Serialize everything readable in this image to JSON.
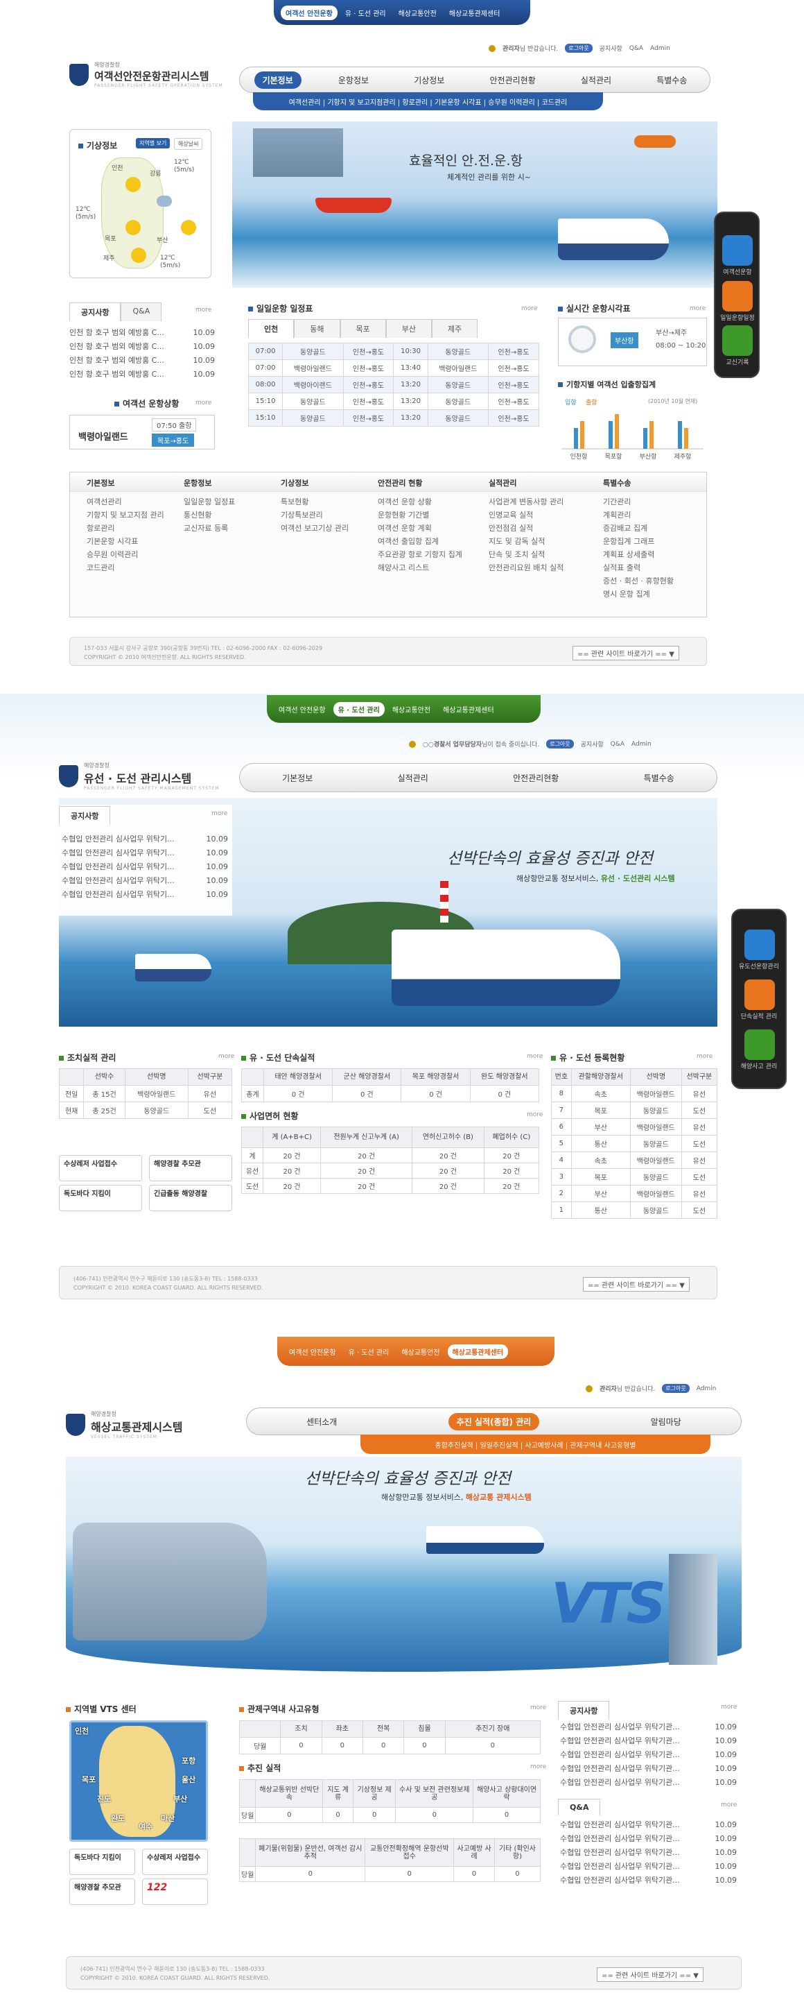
{
  "s1": {
    "topnav": [
      "여객선 안전운항",
      "유 · 도선 관리",
      "해상교통안전",
      "해상교통관제센터"
    ],
    "logo": {
      "sub": "해양경찰청",
      "main": "여객선안전운항관리시스템",
      "eng": "PASSENGER FLIGHT SAFETY OPERATION SYSTEM"
    },
    "util": {
      "user": "관리자",
      "greet": "님 반갑습니다.",
      "logout": "로그아웃",
      "q1": "공지사항",
      "q2": "Q&A",
      "q3": "Admin"
    },
    "mainmenu": [
      "기본정보",
      "운항정보",
      "기상정보",
      "안전관리현황",
      "실적관리",
      "특별수송"
    ],
    "submenu": "여객선관리 | 기항지 및 보고지점관리 | 항로관리 | 기본운항 시각표 | 승무원 이력관리 | 코드관리",
    "weather": {
      "title": "기상정보",
      "btn1": "지역별 보기",
      "btn2": "해상날씨",
      "cities": [
        "인천",
        "강릉",
        "목포",
        "부산",
        "제주"
      ],
      "readings": [
        "12℃ (5m/s)",
        "12℃ (5m/s)",
        "12℃ (5m/s)"
      ]
    },
    "hero": {
      "title": "효율적인 안.전.운.항",
      "sub": "체계적인 관리를 위한 시~"
    },
    "notice": {
      "tab1": "공지사항",
      "tab2": "Q&A",
      "more": "more",
      "items": [
        {
          "t": "인천 항 호구 범외 예방홍 C...",
          "d": "10.09"
        },
        {
          "t": "인천 항 호구 범외 예방홍 C...",
          "d": "10.09"
        },
        {
          "t": "인천 항 호구 범외 예방홍 C...",
          "d": "10.09"
        },
        {
          "t": "인천 항 호구 범외 예방홍 C...",
          "d": "10.09"
        }
      ]
    },
    "status": {
      "title": "여객선 운항상황",
      "more": "more",
      "ship": "백령아일랜드",
      "time": "07:50 출항",
      "route": "목포→홍도"
    },
    "schedule": {
      "title": "일일운항 일정표",
      "more": "more",
      "tabs": [
        "인천",
        "동해",
        "목포",
        "부산",
        "제주"
      ],
      "rows": [
        [
          "07:00",
          "동양골드",
          "인천→홍도",
          "10:30",
          "동양골드",
          "인천→홍도"
        ],
        [
          "07:00",
          "백령아일랜드",
          "인천→홍도",
          "13:40",
          "백령아일랜드",
          "인천→홍도"
        ],
        [
          "08:00",
          "백령아이랜드",
          "인천→홍도",
          "13:20",
          "동양골드",
          "인천→홍도"
        ],
        [
          "15:10",
          "동양골드",
          "인천→홍도",
          "13:20",
          "동양골드",
          "인천→홍도"
        ],
        [
          "15:10",
          "동양골드",
          "인천→홍도",
          "13:20",
          "동양골드",
          "인천→홍도"
        ]
      ]
    },
    "realtime": {
      "title": "실시간 운항시각표",
      "more": "more",
      "port": "부산항",
      "route": "부산→제주",
      "time": "08:00 ~ 10:20"
    },
    "pax": {
      "title": "기항지별 여객선 입출항집계",
      "legend1": "입항",
      "legend2": "출항",
      "note": "(2010년 10월 현재)",
      "cats": [
        "인천항",
        "목포항",
        "부산항",
        "제주항"
      ],
      "in": [
        3,
        4,
        3,
        4
      ],
      "out": [
        4,
        5,
        4,
        3
      ]
    },
    "phone": [
      "여객선운항",
      "일일운항일정",
      "교신기록"
    ],
    "sitemap": [
      {
        "h": "기본정보",
        "i": [
          "여객선관리",
          "기항지 및 보고지점 관리",
          "항로관리",
          "기본운항 시각표",
          "승무원 이력관리",
          "코드관리"
        ]
      },
      {
        "h": "운항정보",
        "i": [
          "일일운항 일정표",
          "통신현황",
          "교신자료 등록"
        ]
      },
      {
        "h": "기상정보",
        "i": [
          "특보현황",
          "기상특보관리",
          "여객선 보고기상 관리"
        ]
      },
      {
        "h": "안전관리 현황",
        "i": [
          "여객선 운항 상황",
          "운항현황 기간별",
          "여객선 운항 계획",
          "여객선 출입항 집계",
          "주요관광 항로 기항지 집계",
          "해양사고 리스트"
        ]
      },
      {
        "h": "실적관리",
        "i": [
          "사업관계 변동사항 관리",
          "인명교육 실적",
          "안전점검 실적",
          "지도 및 감독 실적",
          "단속 및 조치 실적",
          "안전관리요원 배치 실적"
        ]
      },
      {
        "h": "특별수송",
        "i": [
          "기간관리",
          "계획관리",
          "증감배교 집계",
          "운항집계 그래프",
          "계획표 상세출력",
          "실적표 출력",
          "증선 · 회선 · 휴항현황",
          "명시 운항 집계"
        ]
      }
    ],
    "footer": {
      "l1": "157-033 서울시 강서구 공항로 390(공항동 39번지) TEL : 02-6096-2000  FAX : 02-6096-2029",
      "l2": "COPYRIGHT © 2010 여객선안전운항. ALL RIGHTS RESERVED.",
      "sel": "== 관련 사이트 바로가기 ==",
      "arrow": "▼"
    }
  },
  "s2": {
    "topnav": [
      "여객선 안전운항",
      "유 · 도선 관리",
      "해상교통안전",
      "해상교통관제센터"
    ],
    "logo": {
      "sub": "해양경찰청",
      "main": "유선 · 도선 관리시스템",
      "eng": "PASSENGER FLIGHT SAFETY MANAGEMENT SYSTEM"
    },
    "util": {
      "user": "○○경찰서 업무담당자",
      "greet": "님이 접속 중이십니다.",
      "logout": "로그아웃",
      "q1": "공지사항",
      "q2": "Q&A",
      "q3": "Admin"
    },
    "mainmenu": [
      "기본정보",
      "실적관리",
      "안전관리현황",
      "특별수송"
    ],
    "notice": {
      "title": "공지사항",
      "more": "more",
      "items": [
        {
          "t": "수협입 안전관리 심사업무 위탁기...",
          "d": "10.09"
        },
        {
          "t": "수협입 안전관리 심사업무 위탁기...",
          "d": "10.09"
        },
        {
          "t": "수협입 안전관리 심사업무 위탁기...",
          "d": "10.09"
        },
        {
          "t": "수협입 안전관리 심사업무 위탁기...",
          "d": "10.09"
        },
        {
          "t": "수협입 안전관리 심사업무 위탁기...",
          "d": "10.09"
        }
      ]
    },
    "hero": {
      "title": "선박단속의 효율성 증진과 안전",
      "sub1": "해상항만교통 정보서비스, ",
      "sub2": "유선 · 도선관리 시스템"
    },
    "phone": [
      "유도선운항관리",
      "단속실적 관리",
      "해양사고 관리"
    ],
    "inspect": {
      "title": "조치실적 관리",
      "more": "more",
      "head": [
        "선박수",
        "선박명",
        "선박구분"
      ],
      "rows": [
        [
          "전일",
          "총 15건",
          "백령아일랜드",
          "유선"
        ],
        [
          "현재",
          "총 25건",
          "동양골드",
          "도선"
        ]
      ]
    },
    "btns": [
      "수상레저 사업접수",
      "해양경찰 추모관",
      "독도바다 지킴이",
      "긴급출동 해양경찰"
    ],
    "crack": {
      "title": "유 · 도선 단속실적",
      "more": "more",
      "head": [
        "태안 해양경찰서",
        "군산 해양경찰서",
        "목포 해양경찰서",
        "완도 해양경찰서"
      ],
      "rows": [
        [
          "총계",
          "0 건",
          "0 건",
          "0 건",
          "0 건"
        ]
      ]
    },
    "biz": {
      "title": "사업면허 현황",
      "more": "more",
      "head": [
        "계 (A+B+C)",
        "전원누계 신고누계 (A)",
        "연허신고허수 (B)",
        "폐업허수 (C)"
      ],
      "rows": [
        [
          "계",
          "20 건",
          "20 건",
          "20 건",
          "20 건"
        ],
        [
          "유선",
          "20 건",
          "20 건",
          "20 건",
          "20 건"
        ],
        [
          "도선",
          "20 건",
          "20 건",
          "20 건",
          "20 건"
        ]
      ]
    },
    "reg": {
      "title": "유 · 도선 등록현황",
      "more": "more",
      "head": [
        "번호",
        "관할해양경찰서",
        "선박명",
        "선박구분"
      ],
      "rows": [
        [
          "8",
          "속초",
          "백령아일랜드",
          "유선"
        ],
        [
          "7",
          "목포",
          "동양골드",
          "도선"
        ],
        [
          "6",
          "부산",
          "백령아일랜드",
          "유선"
        ],
        [
          "5",
          "통산",
          "동양골드",
          "도선"
        ],
        [
          "4",
          "속초",
          "백령아일랜드",
          "유선"
        ],
        [
          "3",
          "목포",
          "동양골드",
          "도선"
        ],
        [
          "2",
          "부산",
          "백령아일랜드",
          "유선"
        ],
        [
          "1",
          "통산",
          "동양골드",
          "도선"
        ]
      ]
    },
    "footer": {
      "l1": "(406-741) 인천광역시 연수구 해돋이로 130 (송도동3-8) TEL : 1588-0333",
      "l2": "COPYRIGHT © 2010. KOREA COAST GUARD. ALL RIGHTS RESERVED.",
      "sel": "== 관련 사이트 바로가기 ==",
      "arrow": "▼"
    }
  },
  "s3": {
    "topnav": [
      "여객선 안전운항",
      "유 · 도선 관리",
      "해상교통안전",
      "해상교통관제센터"
    ],
    "logo": {
      "sub": "해양경찰청",
      "main": "해상교통관제시스템",
      "eng": "VESSEL TRAFFIC SYSTEM"
    },
    "util": {
      "user": "관리자",
      "greet": "님 반갑습니다.",
      "logout": "로그아웃",
      "q1": "Admin"
    },
    "mainmenu": [
      "센터소개",
      "추진 실적(종합) 관리",
      "알림마당"
    ],
    "submenu": "종합추진실적 | 일일추진실적 | 사고예방사례 | 관제구역내 사고유형별",
    "hero": {
      "title": "선박단속의 효율성 증진과 안전",
      "sub1": "해상항만교통 정보서비스, ",
      "sub2": "해상교통 관제시스템",
      "vts": "VTS"
    },
    "vtsmap": {
      "title": "지역별 VTS 센터",
      "cities": [
        "인천",
        "포항",
        "목포",
        "울산",
        "진도",
        "부산",
        "완도",
        "여수",
        "마산"
      ]
    },
    "btns": [
      "독도바다 지킴이",
      "수상레저 사업접수",
      "해양경찰 추모관",
      "122"
    ],
    "accident": {
      "title": "관제구역내 사고유형",
      "more": "more",
      "head": [
        "조치",
        "좌초",
        "전복",
        "침몰",
        "추진기 장애"
      ],
      "rows": [
        [
          "당월",
          "0",
          "0",
          "0",
          "0",
          "0"
        ]
      ]
    },
    "perf": {
      "title": "추진 실적",
      "more": "more",
      "head1": [
        "해상교통위반 선박단속",
        "지도 계류",
        "기상정보 제공",
        "수사 및 보전 관련정보제공",
        "해양사고 상황대이연락"
      ],
      "rows1": [
        [
          "당월",
          "0",
          "0",
          "0",
          "0",
          "0"
        ]
      ],
      "head2": [
        "폐기물(위험물) 운반선, 여객선 감시추적",
        "교통안전확정해역 운항선박 접수",
        "사고예방 사례",
        "기타 (확인사항)"
      ],
      "rows2": [
        [
          "당월",
          "0",
          "0",
          "0",
          "0"
        ]
      ]
    },
    "notice": {
      "title": "공지사항",
      "more": "more",
      "items": [
        {
          "t": "수협입 안전관리 심사업무 위탁기관...",
          "d": "10.09"
        },
        {
          "t": "수협입 안전관리 심사업무 위탁기관...",
          "d": "10.09"
        },
        {
          "t": "수협입 안전관리 심사업무 위탁기관...",
          "d": "10.09"
        },
        {
          "t": "수협입 안전관리 심사업무 위탁기관...",
          "d": "10.09"
        },
        {
          "t": "수협입 안전관리 심사업무 위탁기관...",
          "d": "10.09"
        }
      ]
    },
    "qna": {
      "title": "Q&A",
      "more": "more",
      "items": [
        {
          "t": "수협입 안전관리 심사업무 위탁기관...",
          "d": "10.09"
        },
        {
          "t": "수협입 안전관리 심사업무 위탁기관...",
          "d": "10.09"
        },
        {
          "t": "수협입 안전관리 심사업무 위탁기관...",
          "d": "10.09"
        },
        {
          "t": "수협입 안전관리 심사업무 위탁기관...",
          "d": "10.09"
        },
        {
          "t": "수협입 안전관리 심사업무 위탁기관...",
          "d": "10.09"
        }
      ]
    },
    "footer": {
      "l1": "(406-741) 인천광역시 연수구 해돋이로 130 (송도동3-8) TEL : 1588-0333",
      "l2": "COPYRIGHT © 2010. KOREA COAST GUARD. ALL RIGHTS RESERVED.",
      "sel": "== 관련 사이트 바로가기 ==",
      "arrow": "▼"
    }
  },
  "colors": {
    "blue": "#2f63ad",
    "green": "#3d8a2a",
    "orange": "#e9741e",
    "sea": "#5aa9d8"
  }
}
